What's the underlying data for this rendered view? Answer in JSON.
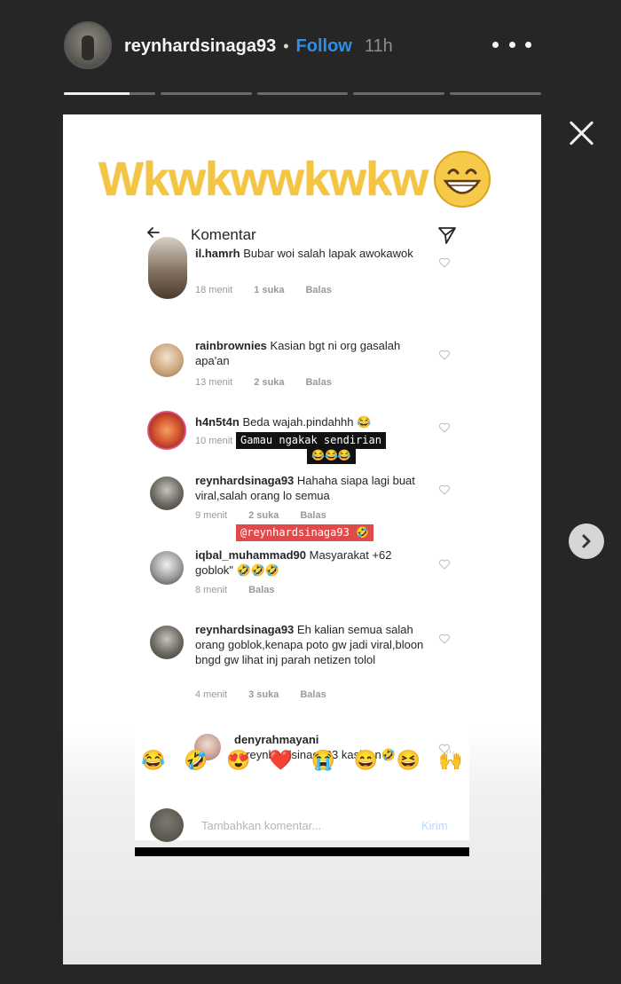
{
  "header": {
    "username": "reynhardsinaga93",
    "separator": "•",
    "follow_label": "Follow",
    "time": "11h",
    "progress": {
      "segments": 5,
      "active_index": 0,
      "active_fraction": 0.72
    }
  },
  "story": {
    "caption": "Wkwkwwkwkw",
    "caption_emoji": "grinning-smiling-face",
    "screenshot": {
      "title": "Komentar",
      "comments": [
        {
          "username": "il.hamrh",
          "text": "Bubar woi salah lapak awokawok",
          "time": "18 menit",
          "likes": "1 suka",
          "reply": "Balas"
        },
        {
          "username": "rainbrownies",
          "text": "Kasian bgt ni org gasalah apa'an",
          "time": "13 menit",
          "likes": "2 suka",
          "reply": "Balas"
        },
        {
          "username": "h4n5t4n",
          "text": "Beda wajah.pindahhh 😂",
          "time": "10 menit",
          "likes": "",
          "reply": ""
        },
        {
          "username": "reynhardsinaga93",
          "text": "Hahaha siapa lagi buat viral,salah orang lo semua",
          "time": "9 menit",
          "likes": "2 suka",
          "reply": "Balas"
        },
        {
          "username": "iqbal_muhammad90",
          "text": "Masyarakat +62 goblok\" 🤣🤣🤣",
          "time": "8 menit",
          "likes": "",
          "reply": "Balas"
        },
        {
          "username": "reynhardsinaga93",
          "text": "Eh kalian semua salah orang goblok,kenapa poto gw jadi viral,bloon bngd gw lihat inj parah netizen tolol",
          "time": "4 menit",
          "likes": "3 suka",
          "reply": "Balas"
        },
        {
          "username": "denyrahmayani",
          "text": "@reynhardsinaga93 kasihan🤣",
          "time": "",
          "likes": "",
          "reply": ""
        }
      ],
      "sticker_black_line1": "Gamau ngakak sendirian",
      "sticker_black_line2": "😂😂😂",
      "sticker_red": "@reynhardsinaga93 🤣",
      "reactions": [
        "😂",
        "🤣",
        "😍",
        "❤️",
        "😭",
        "😄",
        "😆",
        "🙌"
      ],
      "input_placeholder": "Tambahkan komentar...",
      "input_send": "Kirim"
    }
  },
  "colors": {
    "background": "#262626",
    "follow": "#2f8fe8",
    "caption": "#f4c542",
    "sticker_red": "#e04a4a"
  }
}
